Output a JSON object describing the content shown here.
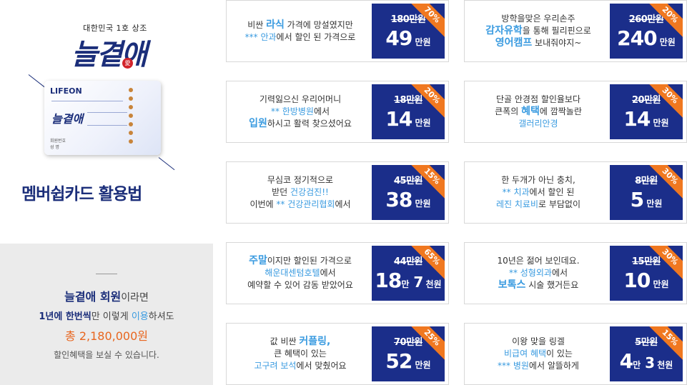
{
  "brand": {
    "subtitle": "대한민국 1호 상조",
    "logo_text": "늘곁애",
    "seal_char": "愛"
  },
  "card": {
    "logo": "LIFEON",
    "title": "늘곁애",
    "foot_line1": "회원번호",
    "foot_line2": "성    명"
  },
  "howto": {
    "title": "멤버쉽카드 활용법"
  },
  "summary": {
    "line1_bold": "늘곁애 회원",
    "line1_rest": "이라면",
    "line2_a": "1년에 한번씩",
    "line2_b": "만 이렇게 ",
    "line2_c": "이용",
    "line2_d": "하셔도",
    "total": "총 2,180,000원",
    "foot": "할인혜택을 보실 수 있습니다."
  },
  "offers": [
    {
      "lines": [
        [
          "비싼 ",
          "라식",
          " 가격에 망설였지만"
        ],
        [
          "*** 안과",
          "에서 할인 된 가격으로"
        ]
      ],
      "orig": "180만원",
      "now_main": "49",
      "now_unit": "만원",
      "discount": "70%"
    },
    {
      "lines": [
        [
          "방학을맞은 우리손주"
        ],
        [
          "감자유학",
          "을 통해 필리핀으로"
        ],
        [
          "영어캠프",
          " 보내줘야지~"
        ]
      ],
      "orig": "260만원",
      "now_main": "240",
      "now_unit": "만원",
      "discount": "20%"
    },
    {
      "lines": [
        [
          "기력잃으신 우리어머니"
        ],
        [
          "** 한방병원",
          "에서"
        ],
        [
          "입원",
          "하시고 활력 찾으셨어요"
        ]
      ],
      "orig": "18만원",
      "now_main": "14",
      "now_unit": "만원",
      "discount": "20%"
    },
    {
      "lines": [
        [
          "단골 안경점 할인율보다"
        ],
        [
          "큰폭의 ",
          "혜택",
          "에 깜짝놀란"
        ],
        [
          "갤러리안경"
        ]
      ],
      "orig": "20만원",
      "now_main": "14",
      "now_unit": "만원",
      "discount": "30%"
    },
    {
      "lines": [
        [
          "무심코 정기적으로"
        ],
        [
          "받던 ",
          "건강검진!!"
        ],
        [
          "이번에 ",
          "** 건강관리협회",
          "에서"
        ]
      ],
      "orig": "45만원",
      "now_main": "38",
      "now_unit": "만원",
      "discount": "15%"
    },
    {
      "lines": [
        [
          "한 두개가 아닌 충치,"
        ],
        [
          "** 치과",
          "에서 할인 된"
        ],
        [
          "레진 치료비",
          "로 부담없이"
        ]
      ],
      "orig": "8만원",
      "now_main": "5",
      "now_unit": "만원",
      "discount": "30%"
    },
    {
      "lines": [
        [
          "주말",
          "이지만 할인된 가격으로"
        ],
        [
          "해운대센텀호텔",
          "에서"
        ],
        [
          "예약할 수 있어 감동 받았어요"
        ]
      ],
      "orig": "44만원",
      "now_main": "18",
      "now_mid_unit": "만",
      "now_second": "7",
      "now_unit": "천원",
      "discount": "65%"
    },
    {
      "lines": [
        [
          "10년은 젊어 보인데요."
        ],
        [
          "** 성형외과",
          "에서"
        ],
        [
          "보톡스",
          " 시술 했거든요"
        ]
      ],
      "orig": "15만원",
      "now_main": "10",
      "now_unit": "만원",
      "discount": "30%"
    },
    {
      "lines": [
        [
          "값 비싼 ",
          "커플링,"
        ],
        [
          "큰 혜택이 있는"
        ],
        [
          "고구려 보석",
          "에서 맞췄어요"
        ]
      ],
      "orig": "70만원",
      "now_main": "52",
      "now_unit": "만원",
      "discount": "25%"
    },
    {
      "lines": [
        [
          "이왕 맞을 링겔"
        ],
        [
          "비급여 혜택",
          "이 있는"
        ],
        [
          "*** 병원",
          "에서 알뜰하게"
        ]
      ],
      "orig": "5만원",
      "now_main": "4",
      "now_mid_unit": "만",
      "now_second": "3",
      "now_unit": "천원",
      "discount": "15%"
    }
  ]
}
